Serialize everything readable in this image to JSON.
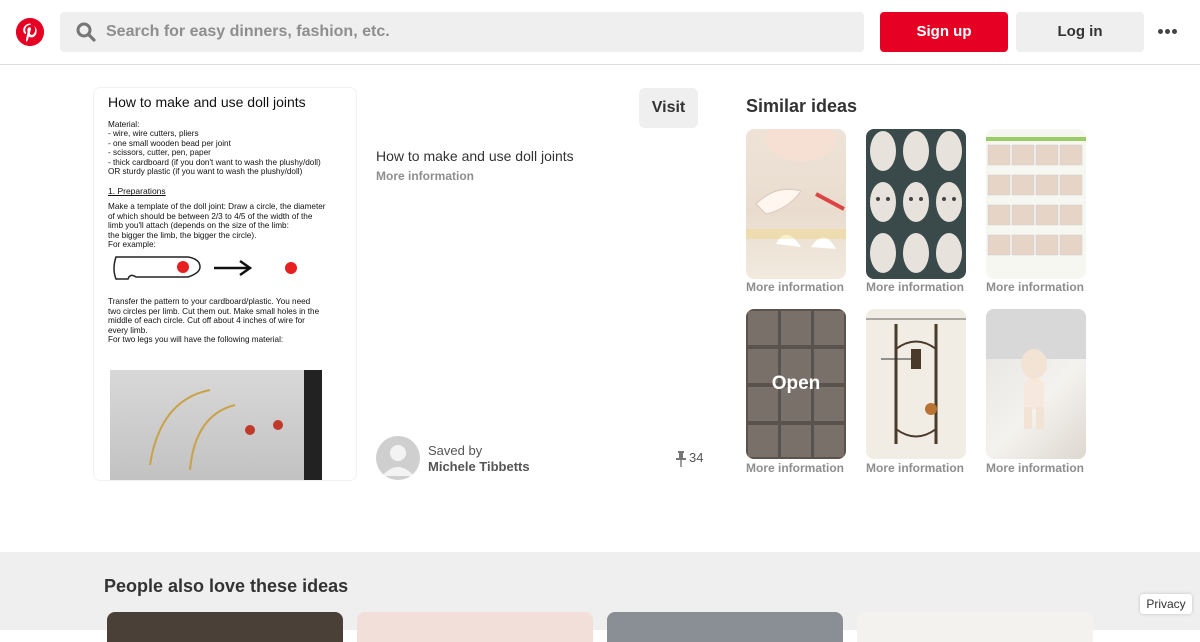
{
  "header": {
    "search_placeholder": "Search for easy dinners, fashion, etc.",
    "signup_label": "Sign up",
    "login_label": "Log in",
    "brand_color": "#e60023"
  },
  "pin": {
    "visit_label": "Visit",
    "title": "How to make and use doll joints",
    "more_info": "More information",
    "saved_by_label": "Saved by",
    "saved_by_name": "Michele Tibbetts",
    "save_count": "34",
    "image_doc": {
      "title": "How to make and use doll joints",
      "material_lines": [
        "Material:",
        "- wire, wire cutters, pliers",
        "- one small wooden bead per joint",
        "- scissors, cutter, pen, paper",
        "- thick cardboard (if you don't want to wash the plushy/doll)",
        "OR sturdy plastic (if you want to wash the plushy/doll)"
      ],
      "section": "1. Preparations",
      "prep_lines": [
        "Make a template of the doll joint: Draw a circle, the diameter",
        "of which should be between 2/3 to 4/5 of the width of the",
        "limb you'll attach (depends on the size of the limb:",
        "the bigger the limb, the bigger the circle).",
        "For example:"
      ],
      "transfer_lines": [
        "Transfer the pattern to your cardboard/plastic. You need",
        "two circles per limb. Cut them out. Make small holes in the",
        "middle of each circle. Cut off about 4 inches of wire for",
        "every limb.",
        "For two legs you will have the following material:"
      ]
    }
  },
  "similar": {
    "title": "Similar ideas",
    "open_label": "Open",
    "items": [
      {
        "label": "More information"
      },
      {
        "label": "More information"
      },
      {
        "label": "More information"
      },
      {
        "label": "More information"
      },
      {
        "label": "More information"
      },
      {
        "label": "More information"
      }
    ]
  },
  "people_also_love": {
    "title": "People also love these ideas"
  },
  "privacy_label": "Privacy"
}
